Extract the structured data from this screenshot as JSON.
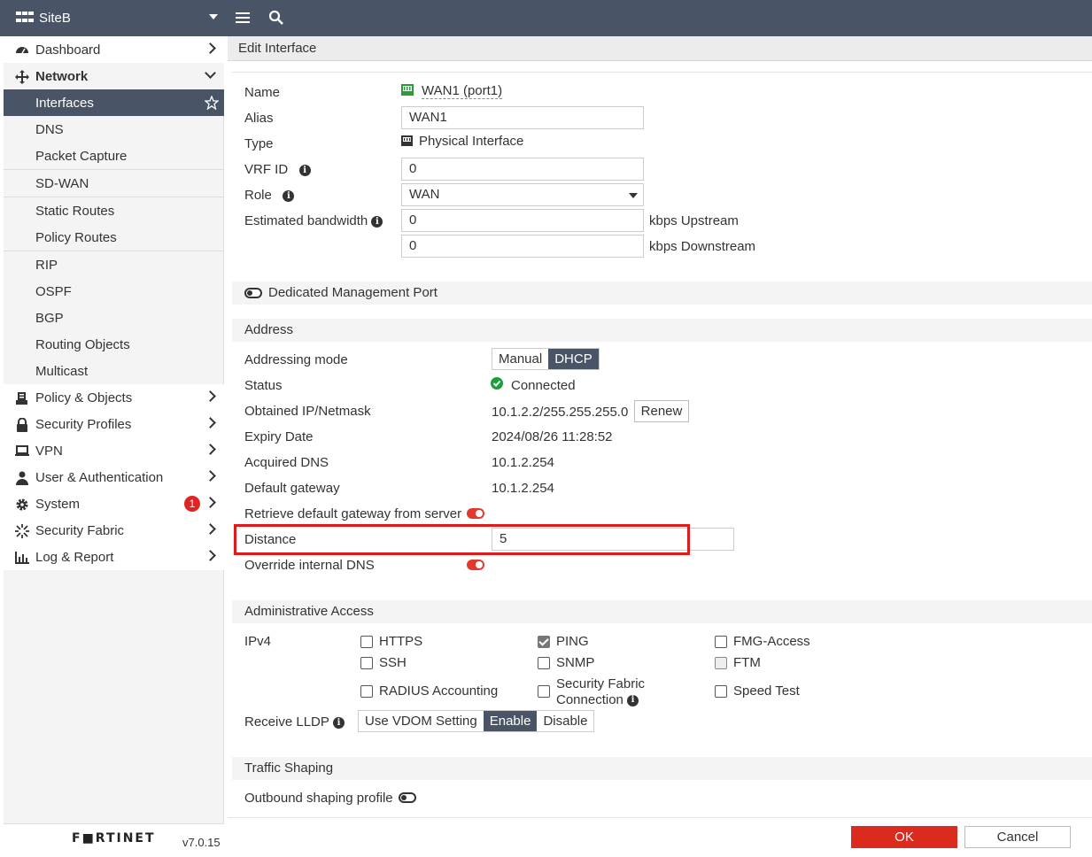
{
  "topbar": {
    "site": "SiteB"
  },
  "sidebar": {
    "items": [
      {
        "label": "Dashboard"
      },
      {
        "label": "Network"
      },
      {
        "label": "Interfaces"
      },
      {
        "label": "DNS"
      },
      {
        "label": "Packet Capture"
      },
      {
        "label": "SD-WAN"
      },
      {
        "label": "Static Routes"
      },
      {
        "label": "Policy Routes"
      },
      {
        "label": "RIP"
      },
      {
        "label": "OSPF"
      },
      {
        "label": "BGP"
      },
      {
        "label": "Routing Objects"
      },
      {
        "label": "Multicast"
      },
      {
        "label": "Policy & Objects"
      },
      {
        "label": "Security Profiles"
      },
      {
        "label": "VPN"
      },
      {
        "label": "User & Authentication"
      },
      {
        "label": "System"
      },
      {
        "label": "Security Fabric"
      },
      {
        "label": "Log & Report"
      }
    ],
    "system_badge": "1",
    "footer": {
      "logo": "F■RTINET",
      "version": "v7.0.15"
    }
  },
  "breadcrumb": "Edit Interface",
  "form": {
    "name_label": "Name",
    "name_value": "WAN1 (port1)",
    "alias_label": "Alias",
    "alias_value": "WAN1",
    "type_label": "Type",
    "type_value": "Physical Interface",
    "vrf_label": "VRF ID",
    "vrf_value": "0",
    "role_label": "Role",
    "role_value": "WAN",
    "bw_label": "Estimated bandwidth",
    "bw_up_value": "0",
    "bw_up_unit": "kbps Upstream",
    "bw_down_value": "0",
    "bw_down_unit": "kbps Downstream",
    "dedicated_mgmt": "Dedicated Management Port"
  },
  "address": {
    "section": "Address",
    "mode_label": "Addressing mode",
    "mode_options": [
      "Manual",
      "DHCP"
    ],
    "status_label": "Status",
    "status_value": "Connected",
    "ip_label": "Obtained IP/Netmask",
    "ip_value": "10.1.2.2/255.255.255.0",
    "renew": "Renew",
    "expiry_label": "Expiry Date",
    "expiry_value": "2024/08/26 11:28:52",
    "dns_label": "Acquired DNS",
    "dns_value": "10.1.2.254",
    "gw_label": "Default gateway",
    "gw_value": "10.1.2.254",
    "retrieve_label": "Retrieve default gateway from server",
    "distance_label": "Distance",
    "distance_value": "5",
    "override_label": "Override internal DNS"
  },
  "admin": {
    "section": "Administrative Access",
    "ipv4_label": "IPv4",
    "https": "HTTPS",
    "ping": "PING",
    "fmg": "FMG-Access",
    "ssh": "SSH",
    "snmp": "SNMP",
    "ftm": "FTM",
    "radius": "RADIUS Accounting",
    "sfc_line1": "Security Fabric",
    "sfc_line2": "Connection",
    "speed": "Speed Test",
    "lldp_label": "Receive LLDP",
    "lldp_options": [
      "Use VDOM Setting",
      "Enable",
      "Disable"
    ]
  },
  "traffic": {
    "section": "Traffic Shaping",
    "outbound_label": "Outbound shaping profile"
  },
  "buttons": {
    "ok": "OK",
    "cancel": "Cancel"
  },
  "colors": {
    "header": "#495567",
    "accent": "#db2b1f",
    "toggle_on": "#e03a2e",
    "connected": "#1e9e3a"
  }
}
